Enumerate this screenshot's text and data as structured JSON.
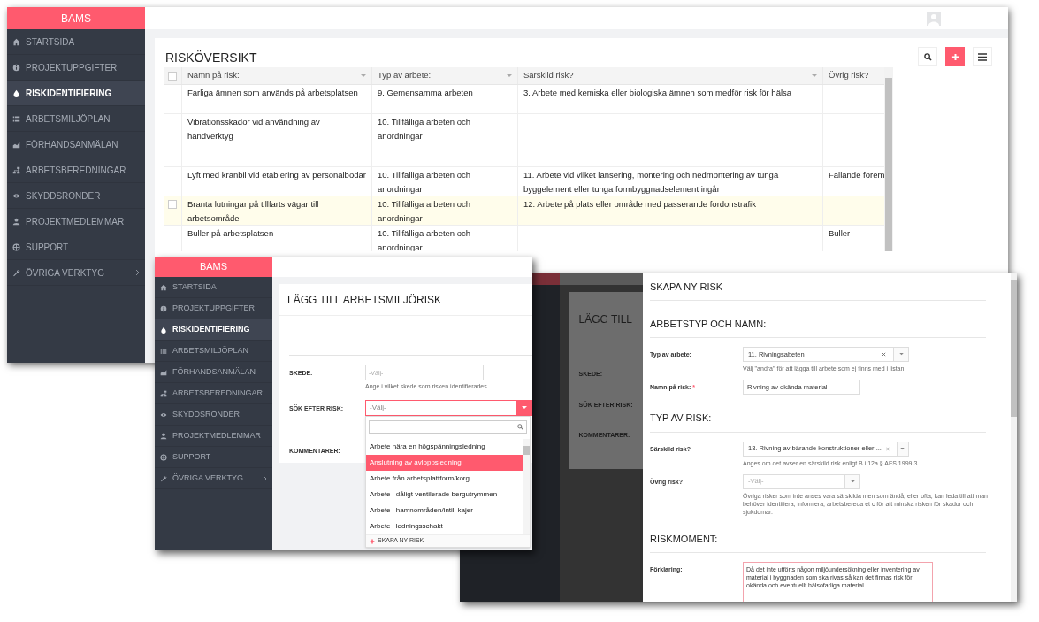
{
  "overview_window": {
    "brand": "BAMS",
    "sidebar": [
      {
        "label": "STARTSIDA",
        "selected": false,
        "submenu": false
      },
      {
        "label": "PROJEKTUPPGIFTER",
        "selected": false,
        "submenu": false
      },
      {
        "label": "RISKIDENTIFIERING",
        "selected": true,
        "submenu": false
      },
      {
        "label": "ARBETSMILJÖPLAN",
        "selected": false,
        "submenu": false
      },
      {
        "label": "FÖRHANDSANMÄLAN",
        "selected": false,
        "submenu": false
      },
      {
        "label": "ARBETSBEREDNINGAR",
        "selected": false,
        "submenu": false
      },
      {
        "label": "SKYDDSRONDER",
        "selected": false,
        "submenu": false
      },
      {
        "label": "PROJEKTMEDLEMMAR",
        "selected": false,
        "submenu": false
      },
      {
        "label": "SUPPORT",
        "selected": false,
        "submenu": false
      },
      {
        "label": "ÖVRIGA VERKTYG",
        "selected": false,
        "submenu": true
      }
    ],
    "title": "RISKÖVERSIKT",
    "select_all_checked": false,
    "columns": [
      {
        "label": "Namn på risk:",
        "sort_arrow": true
      },
      {
        "label": "Typ av arbete:",
        "sort_arrow": true
      },
      {
        "label": "Särskild risk?",
        "sort_arrow": true
      },
      {
        "label": "Övrig risk?",
        "sort_arrow": false
      }
    ],
    "rows": [
      {
        "highlighted": false,
        "cells": [
          "Farliga ämnen som används på arbetsplatsen",
          "9. Gemensamma arbeten",
          "3. Arbete med kemiska eller biologiska ämnen som medför risk för hälsa",
          ""
        ]
      },
      {
        "highlighted": false,
        "cells": [
          "Vibrationsskador vid användning av handverktyg",
          "10. Tillfälliga arbeten och anordningar",
          "",
          ""
        ]
      },
      {
        "highlighted": false,
        "cells": [
          "Lyft med kranbil vid etablering av personalbodar",
          "10. Tillfälliga arbeten och anordningar",
          "11. Arbete vid vilket lansering, montering och nedmontering av tunga byggelement eller tunga formbyggnadselement ingår",
          "Fallande förem"
        ]
      },
      {
        "highlighted": true,
        "cells": [
          "Branta lutningar på tillfarts vägar till arbetsområde",
          "10. Tillfälliga arbeten och anordningar",
          "12. Arbete på plats eller område med passerande fordonstrafik",
          ""
        ]
      },
      {
        "highlighted": false,
        "cells": [
          "Buller på arbetsplatsen",
          "10. Tillfälliga arbeten och anordningar",
          "",
          "Buller"
        ]
      }
    ]
  },
  "add_risk_window": {
    "brand": "BAMS",
    "sidebar": [
      {
        "label": "STARTSIDA",
        "selected": false,
        "submenu": false
      },
      {
        "label": "PROJEKTUPPGIFTER",
        "selected": false,
        "submenu": false
      },
      {
        "label": "RISKIDENTIFIERING",
        "selected": true,
        "submenu": false
      },
      {
        "label": "ARBETSMILJÖPLAN",
        "selected": false,
        "submenu": false
      },
      {
        "label": "FÖRHANDSANMÄLAN",
        "selected": false,
        "submenu": false
      },
      {
        "label": "ARBETSBEREDNINGAR",
        "selected": false,
        "submenu": false
      },
      {
        "label": "SKYDDSRONDER",
        "selected": false,
        "submenu": false
      },
      {
        "label": "PROJEKTMEDLEMMAR",
        "selected": false,
        "submenu": false
      },
      {
        "label": "SUPPORT",
        "selected": false,
        "submenu": false
      },
      {
        "label": "ÖVRIGA VERKTYG",
        "selected": false,
        "submenu": true
      }
    ],
    "title": "LÄGG TILL ARBETSMILJÖRISK",
    "skede": {
      "label": "SKEDE:",
      "placeholder": "-Välj-",
      "hint": "Ange i vilket skede som risken identifierades."
    },
    "search": {
      "label": "SÖK EFTER RISK:",
      "placeholder": "-Välj-"
    },
    "comments_label": "KOMMENTARER:",
    "options": [
      {
        "label": "Arbete nära en högspänningsledning",
        "selected": false
      },
      {
        "label": "Anslutning av avloppsledning",
        "selected": true
      },
      {
        "label": "Arbete från arbetsplattform/korg",
        "selected": false
      },
      {
        "label": "Arbete i dåligt ventilerade bergutrymmen",
        "selected": false
      },
      {
        "label": "Arbete i hamnområden/intill kajer",
        "selected": false
      },
      {
        "label": "Arbete i ledningsschakt",
        "selected": false
      }
    ],
    "create_option": "SKAPA NY RISK"
  },
  "create_risk_window": {
    "background": {
      "title": "LÄGG TILL",
      "labels": [
        "SKEDE:",
        "SÖK EFTER RISK:",
        "KOMMENTARER:"
      ]
    },
    "title": "SKAPA NY RISK",
    "required_mark": "*",
    "sections": [
      {
        "heading": "ARBETSTYP OCH NAMN:",
        "fields": [
          {
            "kind": "select",
            "label": "Typ av arbete:",
            "required": false,
            "value": "11. Rivningsabeten",
            "hint": "Välj \"andra\" för att lägga till arbete som ej finns med i listan."
          },
          {
            "kind": "input",
            "label": "Namn på risk:",
            "required": true,
            "value": "Rivning av okända material"
          }
        ]
      },
      {
        "heading": "TYP AV RISK:",
        "fields": [
          {
            "kind": "select",
            "label": "Särskild risk?",
            "required": false,
            "value": "13. Rivning av bärande konstruktioner eller ...",
            "hint": "Anges om det avser en särskild risk enligt B i 12a § AFS 1999:3."
          },
          {
            "kind": "select",
            "label": "Övrig risk?",
            "required": false,
            "placeholder": "-Välj-",
            "hint": "Övriga risker som inte anses vara särskilda men som ändå, eller ofta, kan leda till att man behöver identifiera, informera, arbetsbereda et c för att minska risken för skador och sjukdomar."
          }
        ]
      },
      {
        "heading": "RISKMOMENT:",
        "fields": [
          {
            "kind": "textarea",
            "label": "Förklaring:",
            "required": false,
            "value": "Då det inte utförts någon miljöundersökning eller inventering av material i byggnaden som ska rivas så kan det finnas risk för okända och eventuellt hälsofarliga material"
          }
        ]
      }
    ]
  }
}
